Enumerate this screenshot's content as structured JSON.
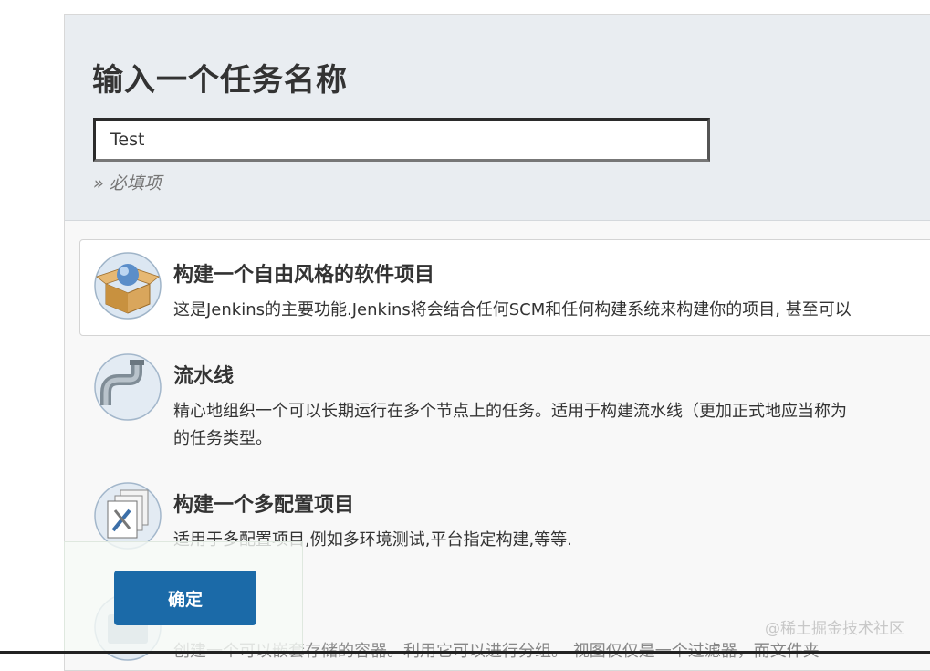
{
  "header": {
    "title": "输入一个任务名称",
    "name_input": {
      "value": "Test",
      "placeholder": ""
    },
    "required_hint": "» 必填项"
  },
  "job_types": [
    {
      "title": "构建一个自由风格的软件项目",
      "description": "这是Jenkins的主要功能.Jenkins将会结合任何SCM和任何构建系统来构建你的项目, 甚至可以",
      "icon": "freestyle-box-icon",
      "selected": true
    },
    {
      "title": "流水线",
      "description": "精心地组织一个可以长期运行在多个节点上的任务。适用于构建流水线（更加正式地应当称为",
      "description_line2": "的任务类型。",
      "icon": "pipeline-icon",
      "selected": false
    },
    {
      "title": "构建一个多配置项目",
      "description": "适用于多配置项目,例如多环境测试,平台指定构建,等等.",
      "icon": "multi-config-icon",
      "selected": false
    },
    {
      "title": "",
      "description": "创建一个可以嵌套存储的容器。利用它可以进行分组。 视图仅仅是一个过滤器，而文件夹",
      "icon": "folder-icon",
      "selected": false
    }
  ],
  "footer": {
    "ok_label": "确定"
  },
  "watermark": "@稀土掘金技术社区",
  "colors": {
    "primary_button": "#1b6aa8",
    "header_bg": "#e9edf1"
  }
}
